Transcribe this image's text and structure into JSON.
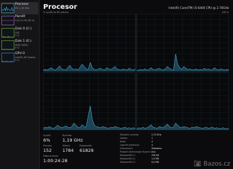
{
  "sidebar": {
    "items": [
      {
        "title": "Procesor",
        "sub": "6%  1,19 GHz",
        "sub2": "",
        "selected": true,
        "curve": [
          2,
          4,
          3,
          6,
          2,
          8,
          3,
          5,
          4,
          2,
          3,
          7,
          2,
          4
        ]
      },
      {
        "title": "Paměť",
        "sub": "3,0/7,9 GB (38 %)",
        "sub2": "",
        "selected": false,
        "curve": [
          6,
          6,
          6,
          6,
          6,
          6,
          6,
          6,
          6,
          6,
          6,
          6,
          6,
          6
        ]
      },
      {
        "title": "Disk 0 (C:)",
        "sub": "SSD",
        "sub2": "0 %",
        "selected": false,
        "curve": [
          0,
          0,
          1,
          0,
          0,
          0,
          0,
          1,
          0,
          0,
          0,
          0,
          0,
          0
        ]
      },
      {
        "title": "Disk 1 (E:)",
        "sub": "HDD (SATA)",
        "sub2": "0 %",
        "selected": false,
        "curve": [
          0,
          0,
          0,
          0,
          0,
          0,
          0,
          0,
          0,
          0,
          0,
          0,
          0,
          0
        ]
      },
      {
        "title": "GPU 0",
        "sub": "Intel(R) HD Graphi...",
        "sub2": "0 %",
        "selected": false,
        "curve": [
          0,
          1,
          0,
          0,
          0,
          1,
          0,
          0,
          0,
          0,
          1,
          0,
          0,
          0
        ]
      }
    ]
  },
  "header": {
    "title": "Procesor",
    "cpu_name": "Intel(R) Core(TM) i5-6400 CPU @ 2.70GHz",
    "graph_caption": "% využití za 60 sekund",
    "graph_max": "100 %"
  },
  "chart_data": {
    "type": "area",
    "title": "",
    "ylim": [
      0,
      100
    ],
    "grid": true,
    "series": [
      {
        "values": [
          2,
          3,
          2,
          4,
          6,
          3,
          2,
          5,
          9,
          4,
          3,
          2,
          6,
          10,
          5,
          3,
          4,
          2,
          7,
          12,
          8,
          4,
          3,
          15,
          6,
          3,
          2,
          4,
          5,
          3,
          2,
          6,
          4,
          3,
          5,
          8,
          4,
          3,
          2,
          4,
          3,
          2,
          5,
          3,
          2,
          4
        ]
      },
      {
        "values": [
          1,
          2,
          3,
          2,
          4,
          2,
          3,
          6,
          3,
          2,
          4,
          5,
          3,
          2,
          4,
          8,
          5,
          3,
          2,
          30,
          12,
          6,
          3,
          8,
          5,
          3,
          4,
          2,
          3,
          4,
          2,
          3,
          2,
          5,
          3,
          4,
          2,
          3,
          6,
          3,
          2,
          4,
          3,
          2,
          3,
          2
        ]
      },
      {
        "values": [
          3,
          5,
          4,
          6,
          4,
          3,
          5,
          8,
          6,
          4,
          5,
          7,
          5,
          4,
          6,
          12,
          8,
          5,
          4,
          9,
          6,
          5,
          25,
          42,
          18,
          8,
          6,
          5,
          4,
          6,
          5,
          4,
          3,
          5,
          4,
          6,
          5,
          4,
          3,
          4,
          5,
          3,
          4,
          3,
          4,
          3
        ]
      },
      {
        "values": [
          2,
          4,
          3,
          5,
          3,
          4,
          6,
          9,
          5,
          4,
          3,
          6,
          5,
          4,
          7,
          10,
          6,
          4,
          5,
          12,
          8,
          5,
          4,
          6,
          5,
          4,
          3,
          5,
          4,
          6,
          5,
          4,
          3,
          4,
          5,
          3,
          4,
          5,
          3,
          4,
          3,
          2,
          4,
          3,
          2,
          3
        ]
      }
    ]
  },
  "stats": [
    {
      "label": "Využití",
      "value": "6%"
    },
    {
      "label": "Rychlost",
      "value": "1,19 GHz"
    },
    {
      "label": "Procesy",
      "value": "152"
    },
    {
      "label": "Vlákna",
      "value": "1784"
    },
    {
      "label": "Popisovače",
      "value": "61829"
    },
    {
      "label": "Doba provozu",
      "value": "1:00:24:28"
    }
  ],
  "specs": [
    {
      "k": "Základní rychlost:",
      "v": "2,70 GHz"
    },
    {
      "k": "Sokety:",
      "v": "1"
    },
    {
      "k": "Jádra:",
      "v": "4"
    },
    {
      "k": "Logické procesory:",
      "v": "4"
    },
    {
      "k": "Virtualizace:",
      "v": "Zakázáno"
    },
    {
      "k": "Podpora technologie Hyper-V:",
      "v": "Ano"
    },
    {
      "k": "Mezipaměť L1:",
      "v": "256 kB"
    },
    {
      "k": "Mezipaměť L2:",
      "v": "1,0 MB"
    },
    {
      "k": "Mezipaměť L3:",
      "v": "6,0 MB"
    }
  ],
  "watermark": "Bazos.cz",
  "colors": {
    "accent": "#4fa6c8",
    "fill": "#1d4e63",
    "bg": "#0b0b0d",
    "grid": "#1c2a30"
  }
}
